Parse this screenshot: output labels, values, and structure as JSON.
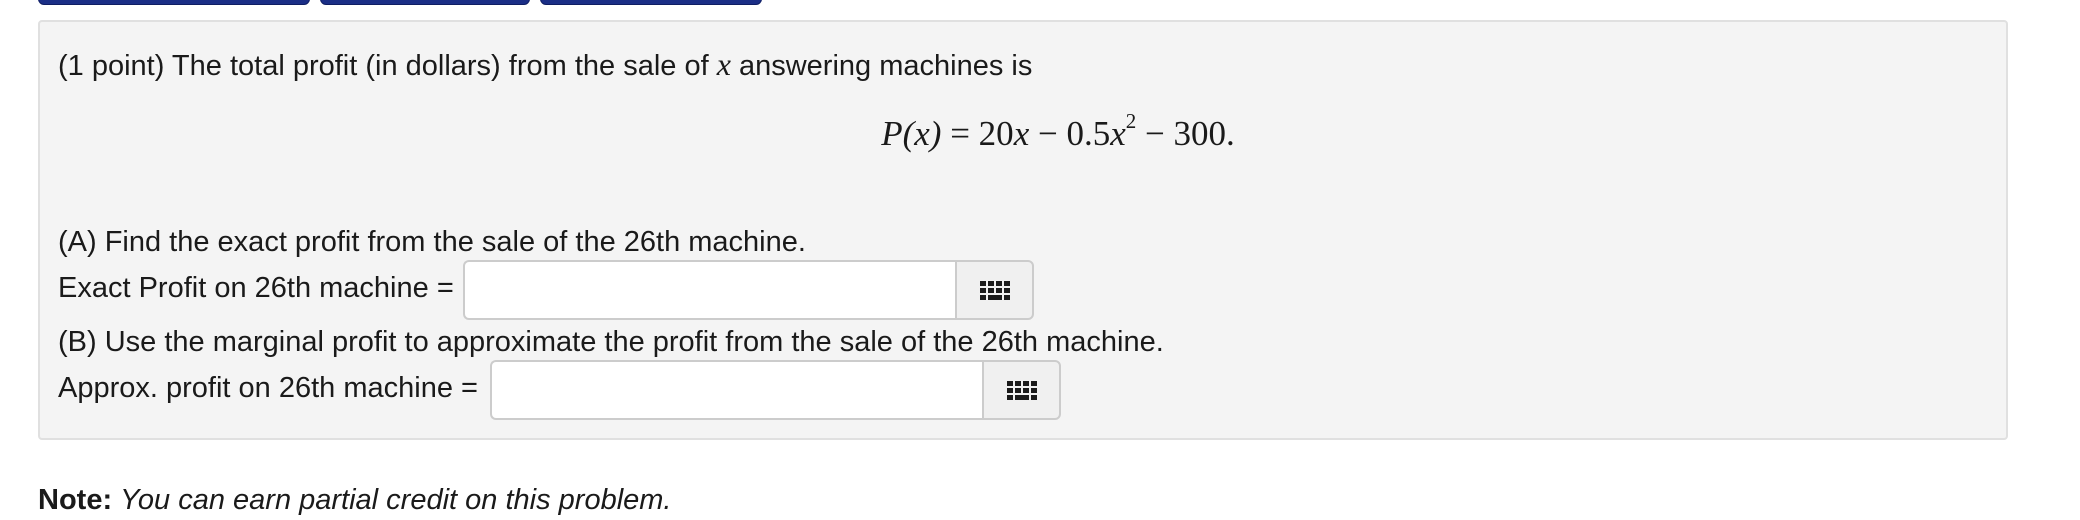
{
  "problem": {
    "intro_prefix": "(1 point) The total profit (in dollars) from the sale of ",
    "intro_var": "x",
    "intro_suffix": " answering machines is",
    "equation": {
      "lhs": "P(x)",
      "eq": " = 20",
      "x1": "x",
      "mid": " − 0.5",
      "x2": "x",
      "exp": "2",
      "tail": " − 300."
    },
    "part_a_prompt": "(A) Find the exact profit from the sale of the 26th machine.",
    "part_a_label": "Exact Profit on 26th machine =",
    "part_a_value": "",
    "part_b_prompt": "(B) Use the marginal profit to approximate the profit from the sale of the 26th machine.",
    "part_b_label": "Approx. profit on 26th machine =",
    "part_b_value": ""
  },
  "note": {
    "label": "Note:",
    "text": "You can earn partial credit on this problem."
  },
  "icons": {
    "keyboard": "grid-keypad-icon"
  }
}
